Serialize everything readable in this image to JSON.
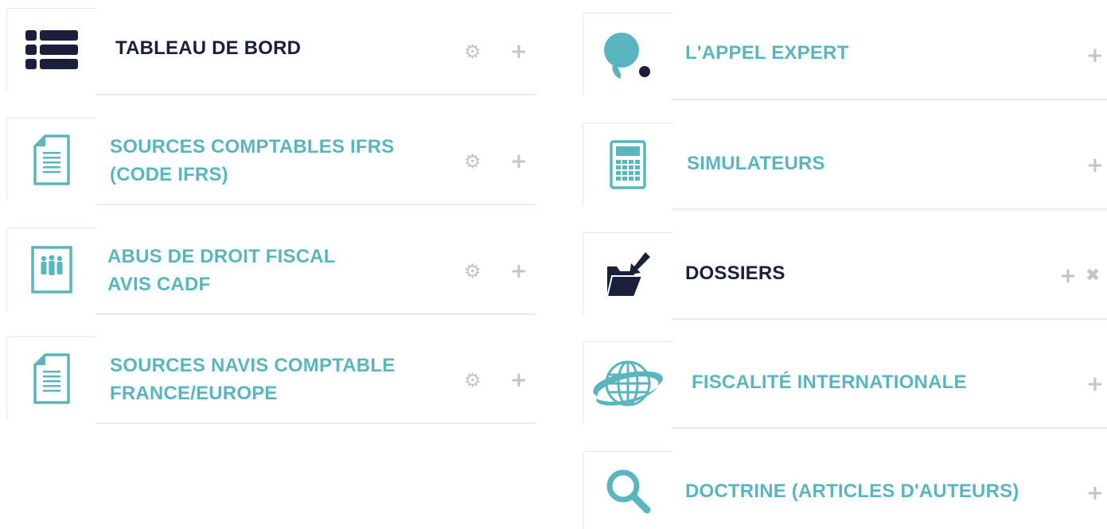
{
  "left_column": {
    "tiles": [
      {
        "icon": "list-icon",
        "lines": [
          "TABLEAU DE BORD"
        ]
      },
      {
        "icon": "document-icon",
        "lines": [
          "SOURCES COMPTABLES IFRS",
          "(CODE IFRS)"
        ]
      },
      {
        "icon": "people-document-icon",
        "lines": [
          "ABUS DE DROIT FISCAL",
          "AVIS CADF"
        ]
      },
      {
        "icon": "document-icon",
        "lines": [
          "SOURCES NAVIS COMPTABLE",
          "FRANCE/EUROPE"
        ]
      }
    ]
  },
  "right_column": {
    "tiles": [
      {
        "icon": "speech-bubble-icon",
        "lines": [
          "L'APPEL EXPERT"
        ]
      },
      {
        "icon": "calculator-icon",
        "lines": [
          "SIMULATEURS"
        ]
      },
      {
        "icon": "folder-icon",
        "lines": [
          "DOSSIERS"
        ]
      },
      {
        "icon": "globe-icon",
        "lines": [
          "FISCALITÉ INTERNATIONALE"
        ]
      },
      {
        "icon": "search-icon",
        "lines": [
          "DOCTRINE (ARTICLES D'AUTEURS)"
        ]
      }
    ]
  },
  "controls": {
    "gear": "⚙",
    "add": "+",
    "remove": "✖"
  },
  "colors": {
    "accent": "#5bb5be",
    "dark": "#1a1f3b",
    "control": "#c4c4c4",
    "divider": "#e9e9e9"
  }
}
